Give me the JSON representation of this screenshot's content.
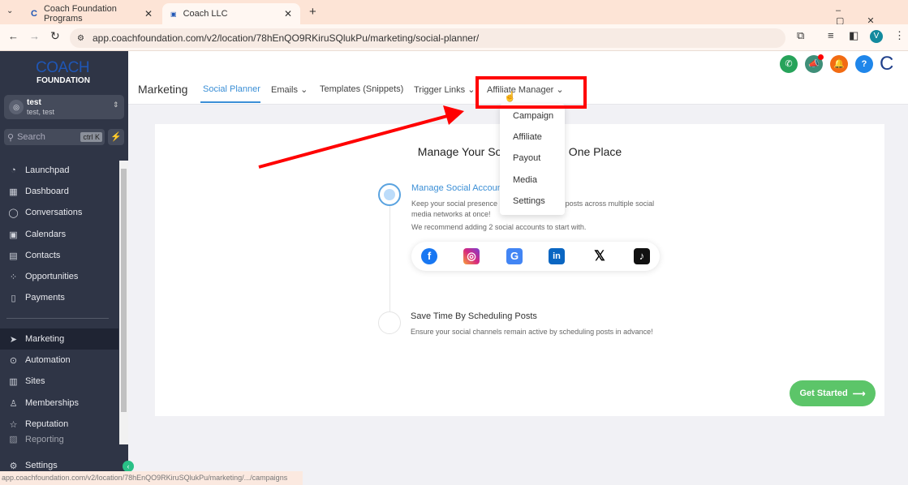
{
  "browser": {
    "tabs": [
      {
        "title": "Coach Foundation Programs"
      },
      {
        "title": "Coach LLC"
      }
    ],
    "url": "app.coachfoundation.com/v2/location/78hEnQO9RKiruSQlukPu/marketing/social-planner/",
    "status_url": "app.coachfoundation.com/v2/location/78hEnQO9RKiruSQlukPu/marketing/.../campaigns",
    "profile_initial": "V"
  },
  "sidebar": {
    "logo_top": "COACH",
    "logo_bottom": "FOUNDATION",
    "account_name": "test",
    "account_sub": "test, test",
    "search_placeholder": "Search",
    "search_shortcut": "ctrl K",
    "items": [
      {
        "label": "Launchpad"
      },
      {
        "label": "Dashboard"
      },
      {
        "label": "Conversations"
      },
      {
        "label": "Calendars"
      },
      {
        "label": "Contacts"
      },
      {
        "label": "Opportunities"
      },
      {
        "label": "Payments"
      },
      {
        "label": "Marketing"
      },
      {
        "label": "Automation"
      },
      {
        "label": "Sites"
      },
      {
        "label": "Memberships"
      },
      {
        "label": "Reputation"
      },
      {
        "label": "Reporting"
      },
      {
        "label": "Settings"
      }
    ]
  },
  "header": {
    "title": "Marketing",
    "tabs": [
      {
        "label": "Social Planner"
      },
      {
        "label": "Emails"
      },
      {
        "label": "Templates (Snippets)"
      },
      {
        "label": "Trigger Links"
      },
      {
        "label": "Affiliate Manager"
      }
    ]
  },
  "dropdown": {
    "items": [
      "Campaign",
      "Affiliate",
      "Payout",
      "Media",
      "Settings"
    ]
  },
  "main": {
    "title": "Manage Your Social Media In One Place",
    "step1_title": "Manage Social Accounts",
    "step1_desc": "Keep your social presence active by publishing posts across multiple social media networks at once!",
    "step1_note": "We recommend adding 2 social accounts to start with.",
    "step2_title": "Save Time By Scheduling Posts",
    "step2_desc": "Ensure your social channels remain active by scheduling posts in advance!",
    "cta": "Get Started"
  },
  "colors": {
    "accent": "#3b8fd6",
    "annotation": "#ff0000",
    "cta": "#5cc569",
    "sidebar": "#2f3546"
  }
}
